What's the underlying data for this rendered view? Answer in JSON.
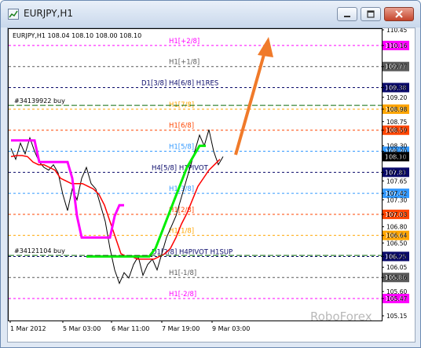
{
  "window": {
    "title": "EURJPY,H1",
    "buttons": [
      "minimize-button",
      "restore-button",
      "close-button"
    ]
  },
  "chart_header": "EURJPY,H1  108.04 108.10 108.00 108.10",
  "watermark": "RoboForex",
  "chart_data": {
    "type": "line",
    "symbol": "EURJPY",
    "timeframe": "H1",
    "ylim": [
      105.15,
      110.45
    ],
    "price_ticks": [
      "110.45",
      "110.16",
      "109.77",
      "109.38",
      "109.20",
      "108.98",
      "108.75",
      "108.59",
      "108.30",
      "108.20",
      "108.10",
      "107.81",
      "107.65",
      "107.42",
      "107.30",
      "107.03",
      "106.80",
      "106.64",
      "106.50",
      "106.25",
      "106.05",
      "105.86",
      "105.60",
      "105.47",
      "105.15"
    ],
    "time_labels": [
      "1 Mar 2012",
      "5 Mar 03:00",
      "6 Mar 11:00",
      "7 Mar 19:00",
      "9 Mar 03:00"
    ],
    "murrey_levels": [
      {
        "label": "H1[+2/8]",
        "price": 110.16,
        "color": "#ff00ff",
        "badge": "110.16"
      },
      {
        "label": "H1[+1/8]",
        "price": 109.77,
        "color": "#5a5a5a",
        "badge": "109.77"
      },
      {
        "label": "D1[3/8] H4[6/8] H1RES",
        "price": 109.38,
        "color": "#0a0a6a",
        "badge": "109.38"
      },
      {
        "label": "H1[7/8]",
        "price": 108.98,
        "color": "#ffa500",
        "badge": "108.98"
      },
      {
        "label": "H1[6/8]",
        "price": 108.59,
        "color": "#ff4500",
        "badge": "108.59"
      },
      {
        "label": "H1[5/8]",
        "price": 108.2,
        "color": "#3399ff",
        "badge": "108.20"
      },
      {
        "label": "H4[5/8] H1PIVOT",
        "price": 107.81,
        "color": "#0a0a6a",
        "badge": "107.81"
      },
      {
        "label": "H1[3/8]",
        "price": 107.42,
        "color": "#3399ff",
        "badge": "107.42"
      },
      {
        "label": "H1[2/8]",
        "price": 107.03,
        "color": "#ff4500",
        "badge": "107.03"
      },
      {
        "label": "H1[1/8]",
        "price": 106.64,
        "color": "#ffa500",
        "badge": "106.64"
      },
      {
        "label": "D1[2/8] H4PIVOT H1SUP",
        "price": 106.25,
        "color": "#0a0a6a",
        "badge": "106.25"
      },
      {
        "label": "H1[-1/8]",
        "price": 105.86,
        "color": "#5a5a5a",
        "badge": "105.86"
      },
      {
        "label": "H1[-2/8]",
        "price": 105.47,
        "color": "#ff00ff",
        "badge": "105.47"
      }
    ],
    "orders": [
      {
        "label": "#34139922 buy",
        "price": 109.05
      },
      {
        "label": "#34121104 buy",
        "price": 106.27
      }
    ],
    "current_price": "108.10",
    "series": [
      {
        "color": "#000000",
        "values": [
          108.25,
          108.05,
          108.35,
          108.15,
          108.45,
          108.2,
          108.0,
          107.9,
          107.85,
          107.95,
          107.8,
          107.4,
          107.1,
          107.5,
          107.3,
          107.7,
          107.9,
          107.6,
          107.5,
          107.2,
          106.9,
          106.4,
          106.0,
          105.75,
          105.95,
          105.85,
          106.1,
          106.25,
          105.9,
          106.1,
          106.2,
          106.0,
          106.3,
          106.6,
          106.8,
          107.0,
          107.3,
          107.6,
          107.9,
          108.2,
          108.5,
          108.3,
          108.6,
          108.2,
          107.95,
          108.1
        ]
      },
      {
        "color": "#ff0000",
        "values": [
          108.1,
          108.12,
          108.12,
          108.1,
          108.0,
          107.95,
          107.95,
          107.9,
          107.85,
          107.7,
          107.65,
          107.6,
          107.6,
          107.6,
          107.55,
          107.5,
          107.4,
          107.2,
          106.9,
          106.6,
          106.3,
          106.25,
          106.25,
          106.2,
          106.2,
          106.2,
          106.2,
          106.25,
          106.3,
          106.4,
          106.6,
          106.85,
          107.05,
          107.3,
          107.55,
          107.7,
          107.85,
          107.95,
          108.05
        ]
      },
      {
        "color": "#ff00ff",
        "values": [
          108.4,
          108.4,
          108.4,
          108.4,
          108.4,
          108.4,
          108.0,
          108.0,
          108.0,
          108.0,
          108.0,
          108.0,
          108.0,
          107.7,
          107.0,
          106.6,
          106.6,
          106.6,
          106.6,
          106.6,
          106.6,
          106.6,
          107.0,
          107.2,
          107.2
        ]
      },
      {
        "color": "#00ee00",
        "values": [
          106.25,
          106.25,
          106.25,
          106.25,
          106.25,
          106.25,
          106.25,
          106.25,
          106.25,
          106.25,
          106.25,
          106.4,
          106.7,
          107.0,
          107.3,
          107.6,
          107.9,
          108.1,
          108.3,
          108.3
        ]
      }
    ]
  }
}
